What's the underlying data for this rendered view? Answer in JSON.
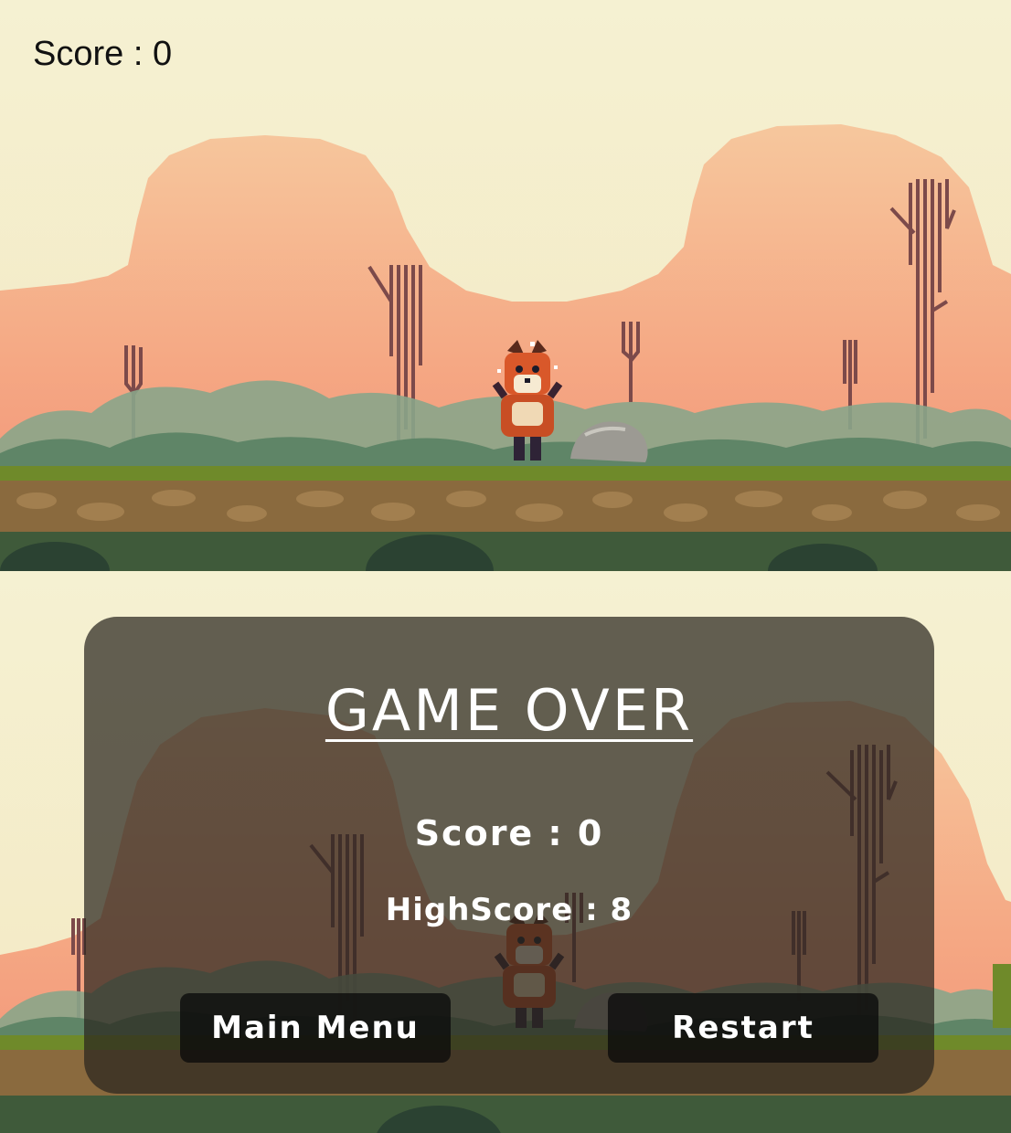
{
  "hud": {
    "score_text": "Score : 0"
  },
  "game_over": {
    "title": "GAME OVER",
    "score_text": "Score : 0",
    "highscore_text": "HighScore : 8",
    "main_menu_label": "Main Menu",
    "restart_label": "Restart"
  },
  "colors": {
    "sky": "#f5f0d0",
    "mountain": "#f4a27a",
    "ground_grass": "#5d7a2c",
    "overlay": "#2a261e",
    "text": "#ffffff"
  },
  "sprites": {
    "player": "fox-icon",
    "obstacle": "rock-icon"
  }
}
